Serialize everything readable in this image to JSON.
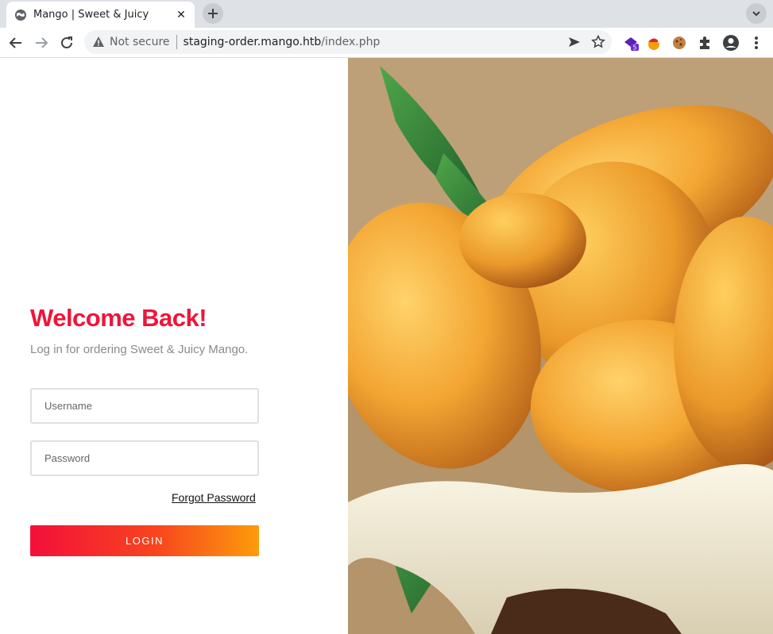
{
  "browser": {
    "tab_title": "Mango | Sweet & Juicy",
    "security_label": "Not secure",
    "url_host": "staging-order.mango.htb",
    "url_path": "/index.php",
    "extension_badge": "5"
  },
  "login": {
    "heading": "Welcome Back!",
    "subheading": "Log in for ordering Sweet & Juicy Mango.",
    "username_placeholder": "Username",
    "password_placeholder": "Password",
    "forgot_label": "Forgot Password",
    "button_label": "LOGIN"
  },
  "colors": {
    "accent": "#f0143a",
    "button_gradient_start": "#f40f3a",
    "button_gradient_end": "#fd9c0b"
  },
  "hero_image": {
    "subject": "mango-basket-photo"
  }
}
